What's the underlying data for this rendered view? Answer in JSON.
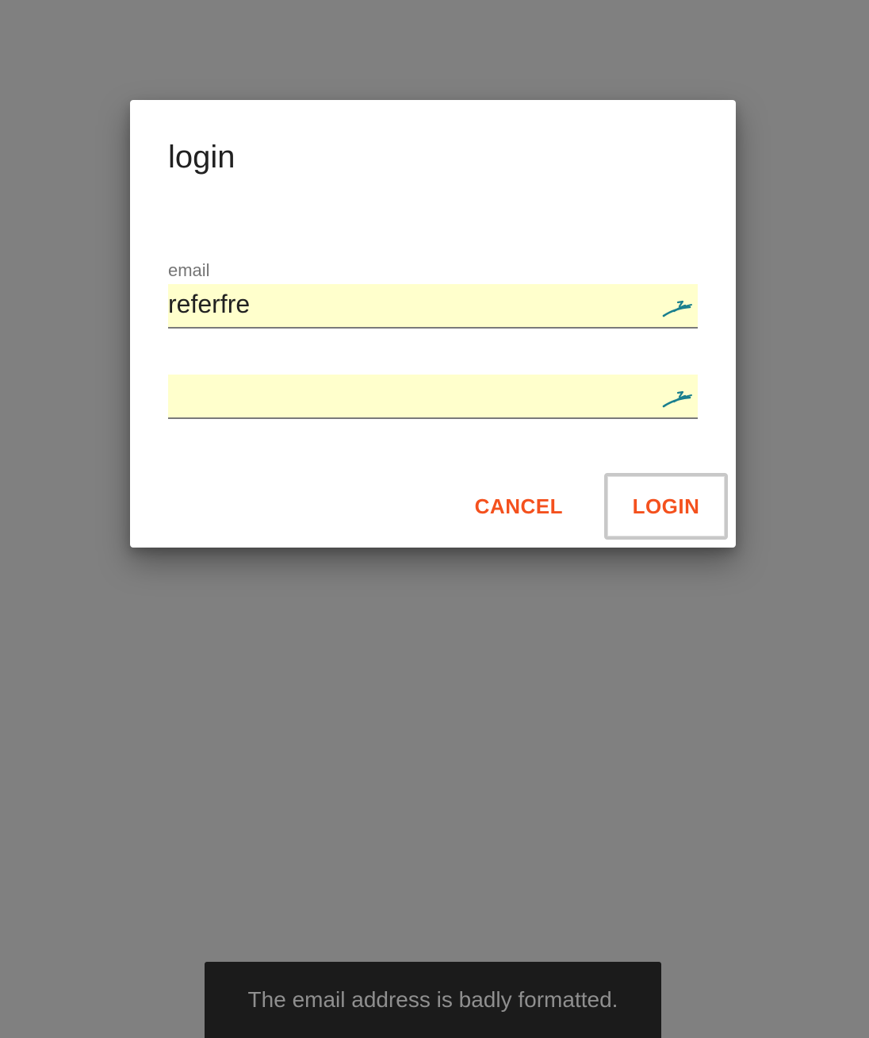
{
  "dialog": {
    "title": "login",
    "email_field": {
      "label": "email",
      "value": "referfre",
      "icon": "autofill-icon"
    },
    "password_field": {
      "label": "",
      "value": "",
      "icon": "autofill-icon"
    },
    "cancel_label": "CANCEL",
    "login_label": "LOGIN"
  },
  "snackbar": {
    "message": "The email address is badly formatted."
  },
  "colors": {
    "overlay": "#808080",
    "accent": "#f4511e",
    "field_autofill_bg": "#ffffcc",
    "snackbar_bg": "#1b1b1b",
    "icon": "#1a7f8e"
  }
}
